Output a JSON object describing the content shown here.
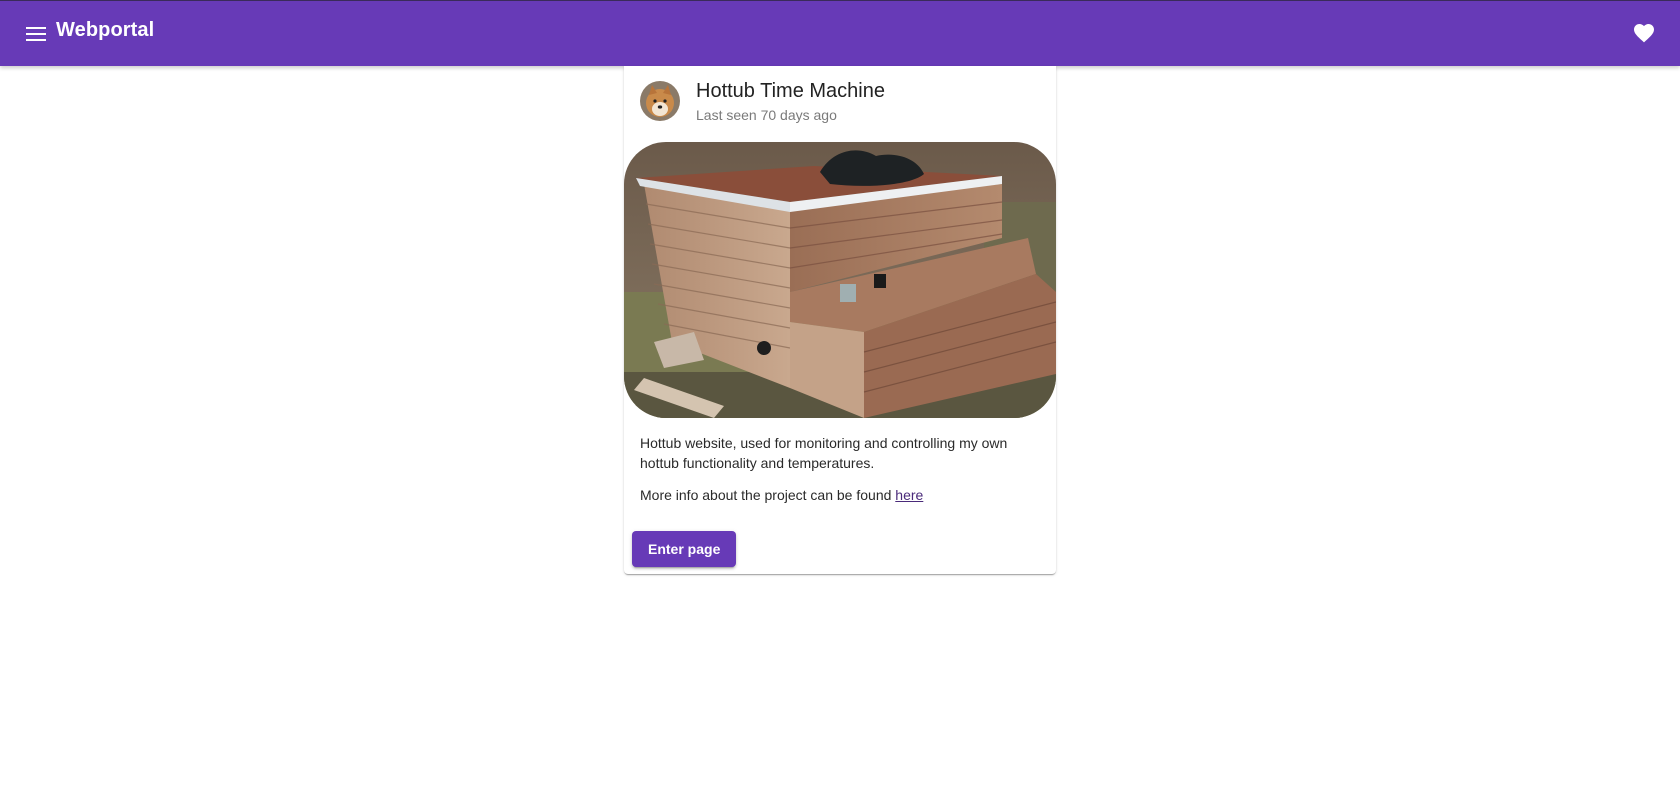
{
  "toolbar": {
    "app_title": "Webportal",
    "menu_icon": "menu-icon",
    "favorite_icon": "heart-icon",
    "background_color": "#673ab7"
  },
  "card": {
    "title": "Hottub Time Machine",
    "subtitle": "Last seen 70 days ago",
    "avatar": "shiba-dog-avatar",
    "image": "wooden-hottub-photo",
    "description": "Hottub website, used for monitoring and controlling my own hottub functionality and temperatures.",
    "more_info_text": "More info about the project can be found ",
    "more_info_link": "here",
    "enter_button": "Enter page",
    "accent_color": "#673ab7"
  }
}
